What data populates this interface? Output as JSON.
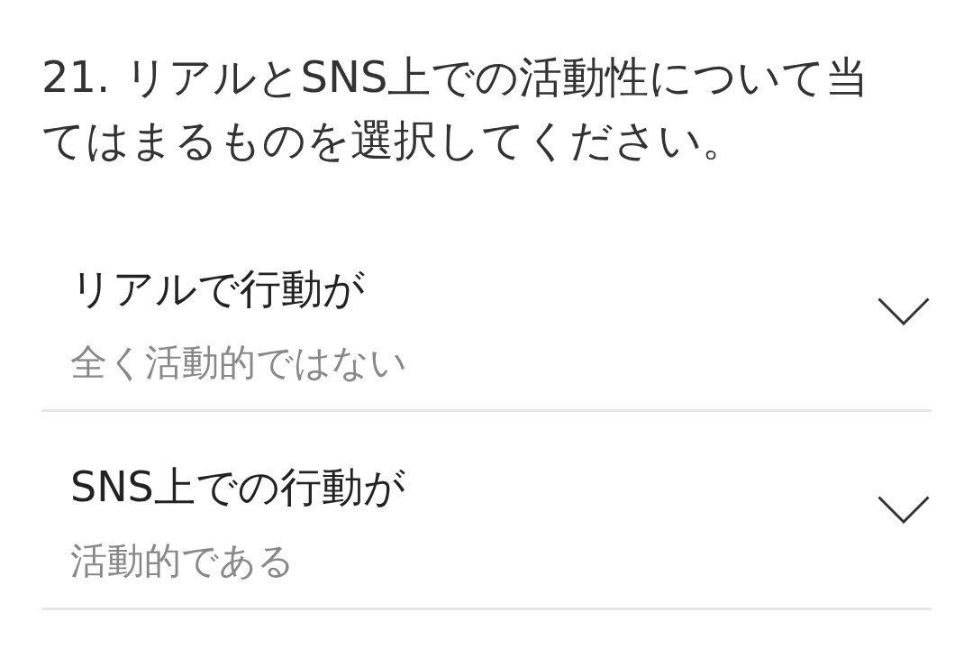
{
  "question": "21. リアルとSNS上での活動性について当てはまるものを選択してください。",
  "dropdowns": [
    {
      "label": "リアルで行動が",
      "value": "全く活動的ではない"
    },
    {
      "label": "SNS上での行動が",
      "value": "活動的である"
    }
  ]
}
